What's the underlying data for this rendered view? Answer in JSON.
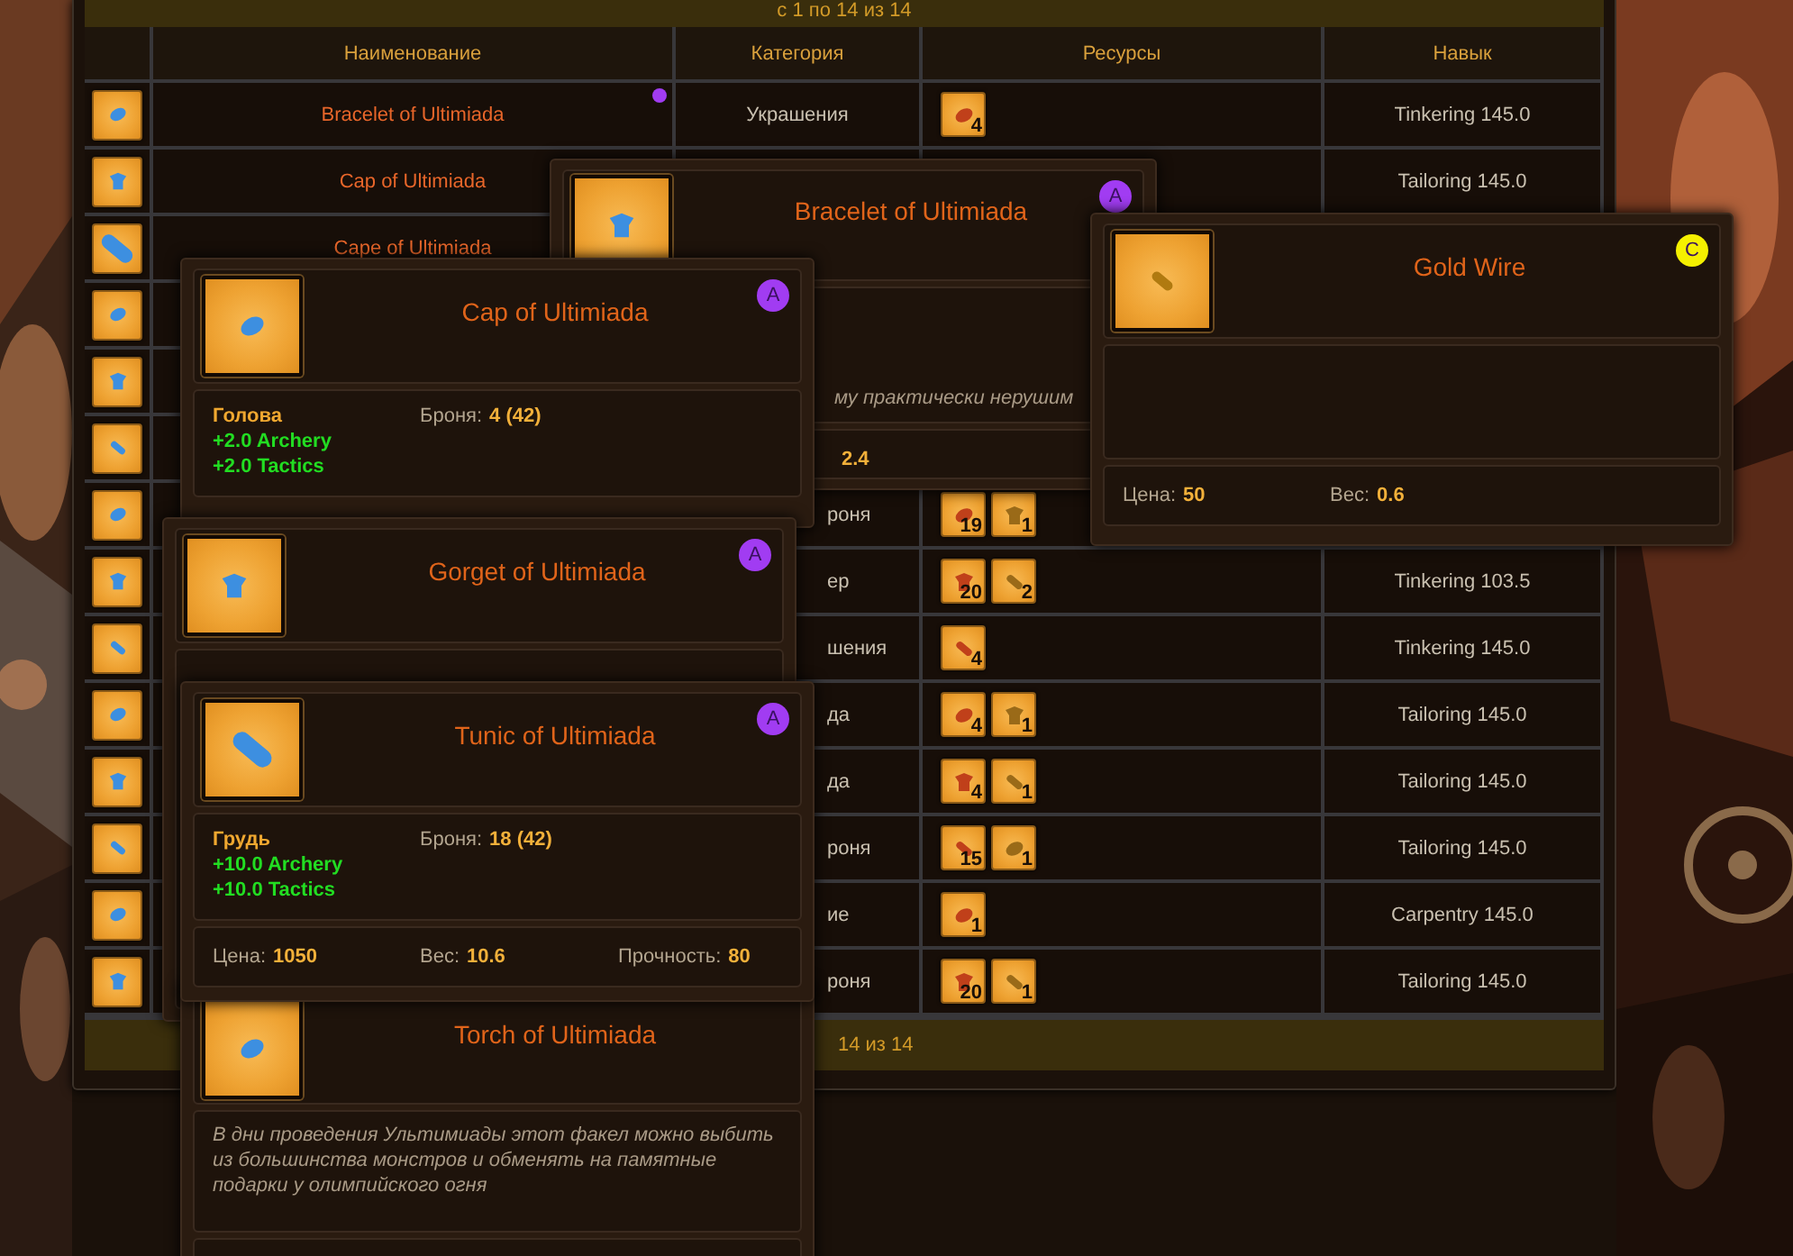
{
  "pager_top": "с 1 по 14 из 14",
  "table": {
    "columns": [
      "Наименование",
      "Категория",
      "Ресурсы",
      "Навык"
    ],
    "rows": [
      {
        "name": "Bracelet of Ultimiada",
        "dot": {
          "color": "#a13cf2"
        },
        "category": "Украшения",
        "category_cut": false,
        "resources": [
          {
            "count": "4"
          }
        ],
        "skill": "Tinkering 145.0"
      },
      {
        "name": "Cap of Ultimiada",
        "skill": "Tailoring 145.0"
      },
      {
        "name": "Cape of Ultimiada"
      },
      {},
      {},
      {},
      {
        "category": "роня",
        "category_cut": true,
        "resources": [
          {
            "count": "19"
          },
          {
            "count": "1"
          }
        ]
      },
      {
        "category": "ер",
        "category_cut": true,
        "resources": [
          {
            "count": "20"
          },
          {
            "count": "2"
          }
        ],
        "skill": "Tinkering 103.5"
      },
      {
        "category": "шения",
        "category_cut": true,
        "resources": [
          {
            "count": "4"
          }
        ],
        "skill": "Tinkering 145.0"
      },
      {
        "category": "да",
        "category_cut": true,
        "resources": [
          {
            "count": "4"
          },
          {
            "count": "1"
          }
        ],
        "skill": "Tailoring 145.0"
      },
      {
        "category": "да",
        "category_cut": true,
        "resources": [
          {
            "count": "4"
          },
          {
            "count": "1"
          }
        ],
        "skill": "Tailoring 145.0"
      },
      {
        "category": "роня",
        "category_cut": true,
        "resources": [
          {
            "count": "15"
          },
          {
            "count": "1"
          }
        ],
        "skill": "Tailoring 145.0"
      },
      {
        "category": "ие",
        "category_cut": true,
        "resources": [
          {
            "count": "1"
          }
        ],
        "skill": "Carpentry 145.0"
      },
      {
        "category": "роня",
        "category_cut": true,
        "resources": [
          {
            "count": "20"
          },
          {
            "count": "1"
          }
        ],
        "skill": "Tailoring 145.0"
      }
    ]
  },
  "pager_bottom": "14 из 14",
  "tooltips": [
    {
      "title": "Cap of Ultimiada",
      "badge": {
        "label": "A",
        "color": "#a13cf2"
      },
      "sections": [
        {
          "kind": "stats",
          "slot": "Голова",
          "armor": {
            "label": "Броня:",
            "value": "4 (42)"
          },
          "bonuses": [
            "+2.0 Archery",
            "+2.0 Tactics"
          ]
        }
      ]
    },
    {
      "title": "Gorget of Ultimiada",
      "badge": {
        "label": "A",
        "color": "#a13cf2"
      },
      "sections": [
        {
          "kind": "blank"
        }
      ]
    },
    {
      "title": "Tunic of Ultimiada",
      "badge": {
        "label": "A",
        "color": "#a13cf2"
      },
      "sections": [
        {
          "kind": "stats",
          "slot": "Грудь",
          "armor": {
            "label": "Броня:",
            "value": "18 (42)"
          },
          "bonuses": [
            "+10.0 Archery",
            "+10.0 Tactics"
          ]
        },
        {
          "kind": "footer",
          "stats": [
            {
              "label": "Цена:",
              "value": "1050"
            },
            {
              "label": "Вес:",
              "value": "10.6"
            },
            {
              "label": "Прочность:",
              "value": "80"
            }
          ]
        }
      ]
    },
    {
      "title": "Torch of Ultimiada",
      "sections": [
        {
          "kind": "description",
          "text": "В дни проведения Ультимиады этот факел можно выбить из большинства монстров и обменять на памятные подарки у олимпийского огня"
        },
        {
          "kind": "blank"
        }
      ]
    },
    {
      "title": "Bracelet of Ultimiada",
      "badge": {
        "label": "A",
        "color": "#a13cf2"
      },
      "sections": [
        {
          "kind": "description",
          "text": "му практически нерушим"
        },
        {
          "kind": "footer",
          "stats": [
            {
              "value": "2.4"
            }
          ]
        }
      ]
    },
    {
      "title": "Gold Wire",
      "badge": {
        "label": "C",
        "color": "#f5f000"
      },
      "sections": [
        {
          "kind": "blank"
        },
        {
          "kind": "footer",
          "stats": [
            {
              "label": "Цена:",
              "value": "50"
            },
            {
              "label": "Вес:",
              "value": "0.6"
            }
          ]
        }
      ]
    }
  ]
}
